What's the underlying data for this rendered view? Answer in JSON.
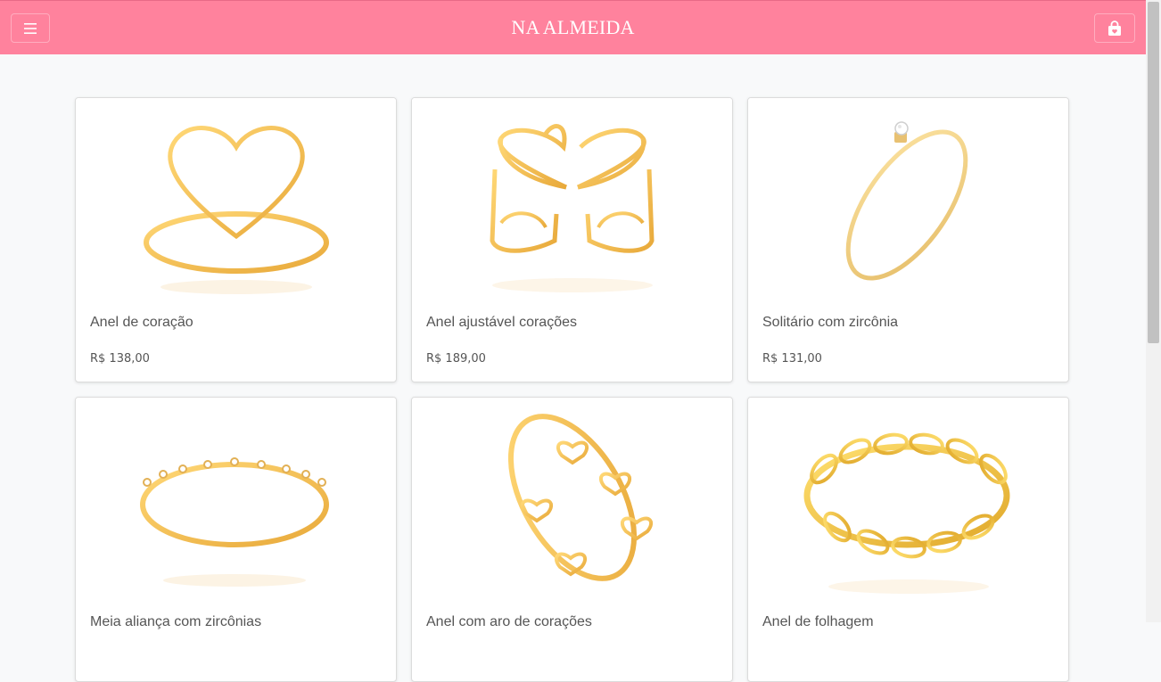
{
  "header": {
    "brand": "NA ALMEIDA",
    "menu_icon": "hamburger-menu-icon",
    "cart_icon": "shopping-bag-icon",
    "background": "#ff829d"
  },
  "products": [
    {
      "name": "Anel de coração",
      "price": "R$ 138,00",
      "image": "heart-ring-image"
    },
    {
      "name": "Anel ajustável corações",
      "price": "R$ 189,00",
      "image": "adjustable-hearts-ring-image"
    },
    {
      "name": "Solitário com zircônia",
      "price": "R$ 131,00",
      "image": "solitaire-ring-image"
    },
    {
      "name": "Meia aliança com zircônias",
      "price": "",
      "image": "half-eternity-ring-image"
    },
    {
      "name": "Anel com aro de corações",
      "price": "",
      "image": "hearts-band-ring-image"
    },
    {
      "name": "Anel de folhagem",
      "price": "",
      "image": "leaf-ring-image"
    }
  ]
}
